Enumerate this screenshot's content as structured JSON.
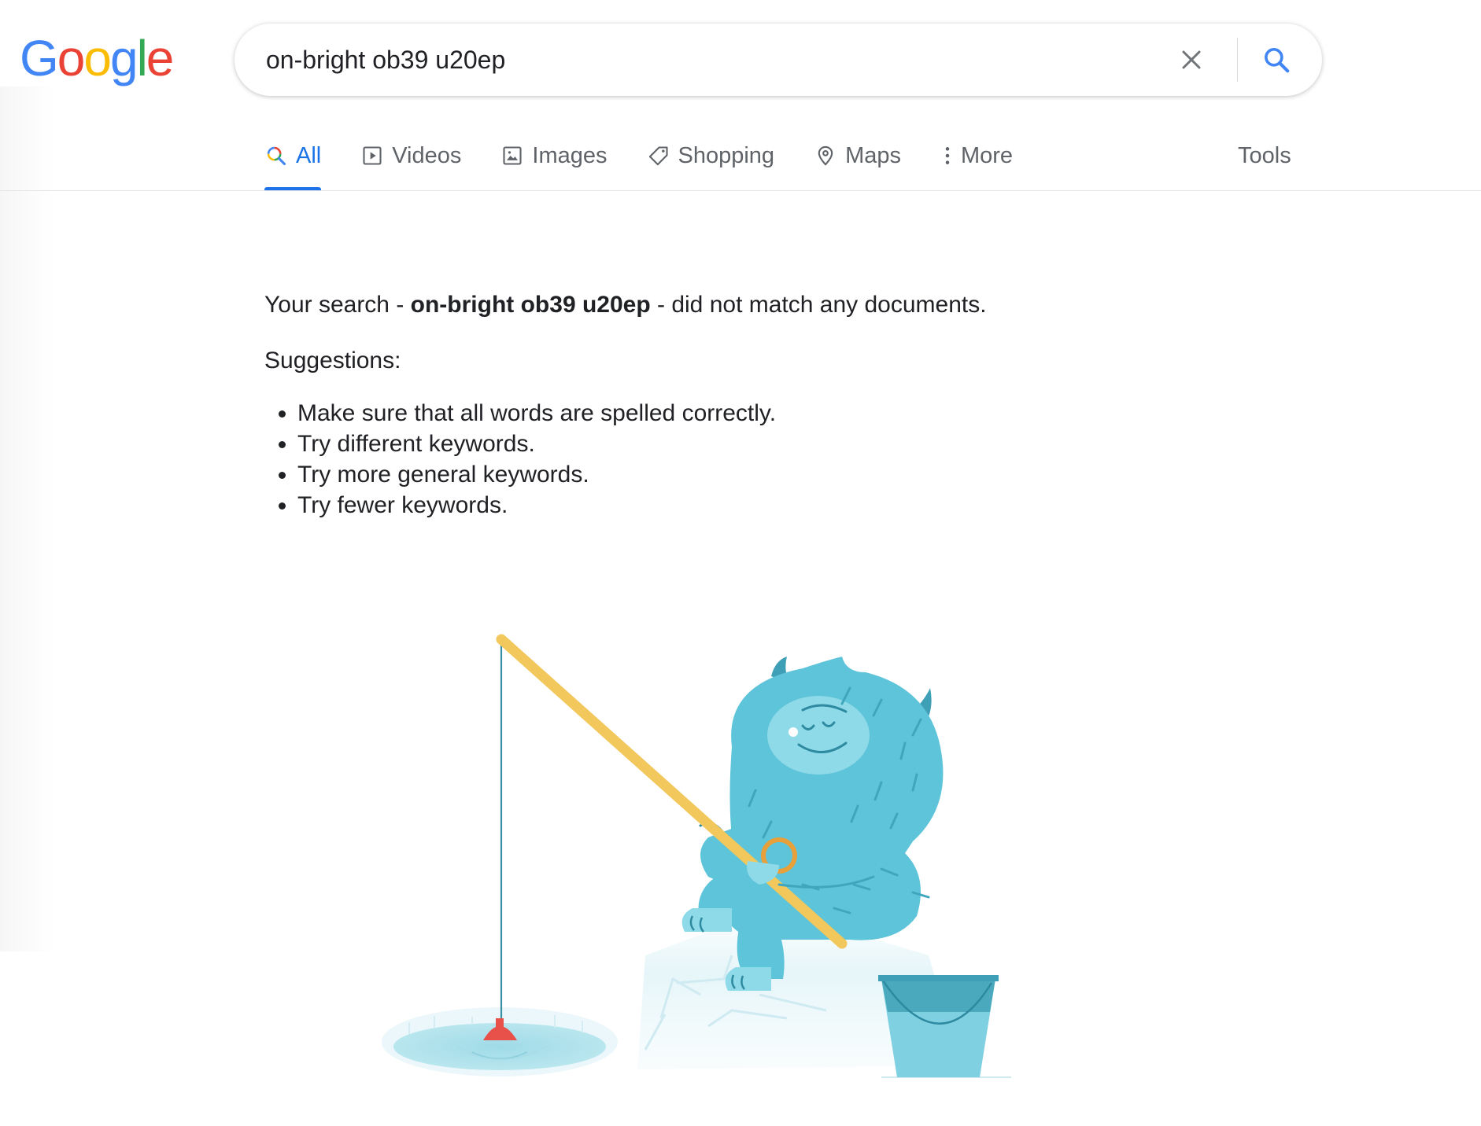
{
  "logo": {
    "letters": [
      "G",
      "o",
      "o",
      "g",
      "l",
      "e"
    ],
    "colors": [
      "#4285F4",
      "#EA4335",
      "#FBBC05",
      "#4285F4",
      "#34A853",
      "#EA4335"
    ]
  },
  "search": {
    "query": "on-bright ob39 u20ep",
    "clear_icon": "close-icon",
    "search_icon": "search-icon"
  },
  "tabs": [
    {
      "label": "All",
      "icon": "search-multicolor-icon",
      "active": true
    },
    {
      "label": "Videos",
      "icon": "play-icon",
      "active": false
    },
    {
      "label": "Images",
      "icon": "image-icon",
      "active": false
    },
    {
      "label": "Shopping",
      "icon": "tag-icon",
      "active": false
    },
    {
      "label": "Maps",
      "icon": "map-pin-icon",
      "active": false
    },
    {
      "label": "More",
      "icon": "more-vert-icon",
      "active": false
    }
  ],
  "tools_label": "Tools",
  "results": {
    "prefix": "Your search - ",
    "query": "on-bright ob39 u20ep",
    "suffix": " - did not match any documents.",
    "suggestions_title": "Suggestions:",
    "suggestions": [
      "Make sure that all words are spelled correctly.",
      "Try different keywords.",
      "Try more general keywords.",
      "Try fewer keywords."
    ]
  },
  "colors": {
    "accent": "#1a73e8",
    "tab_text": "#5f6368",
    "monster": "#5ec4d9",
    "rod": "#f2c75c",
    "bobber": "#e8504a",
    "bucket": "#4aa9bd"
  }
}
